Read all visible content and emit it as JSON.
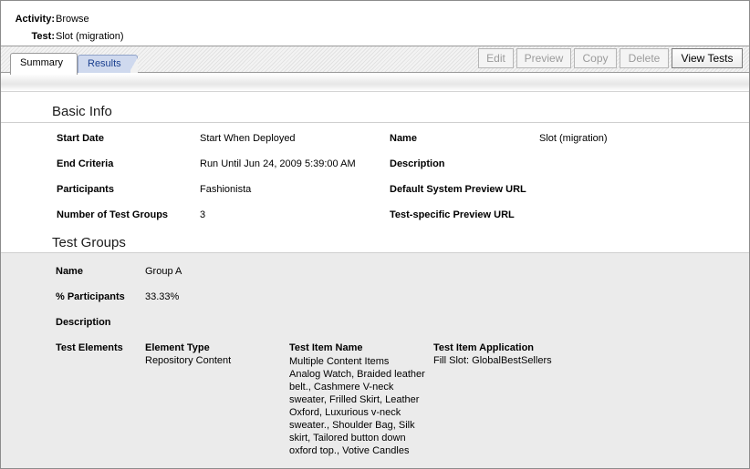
{
  "header": {
    "activity_label": "Activity:",
    "activity_value": "Browse",
    "test_label": "Test:",
    "test_value": "Slot (migration)"
  },
  "tabs": [
    {
      "label": "Summary"
    },
    {
      "label": "Results"
    }
  ],
  "toolbar": {
    "edit": "Edit",
    "preview": "Preview",
    "copy": "Copy",
    "delete": "Delete",
    "view_tests": "View Tests"
  },
  "basic_info": {
    "title": "Basic Info",
    "start_date_label": "Start Date",
    "start_date_value": "Start When Deployed",
    "end_criteria_label": "End Criteria",
    "end_criteria_value": "Run Until Jun 24, 2009 5:39:00 AM",
    "participants_label": "Participants",
    "participants_value": "Fashionista",
    "num_groups_label": "Number of Test Groups",
    "num_groups_value": "3",
    "name_label": "Name",
    "name_value": "Slot (migration)",
    "description_label": "Description",
    "default_preview_label": "Default System Preview URL",
    "test_preview_label": "Test-specific Preview URL"
  },
  "test_groups": {
    "title": "Test Groups",
    "name_label": "Name",
    "name_value": "Group A",
    "participants_label": "% Participants",
    "participants_value": "33.33%",
    "description_label": "Description",
    "elements_label": "Test Elements",
    "element_type_header": "Element Type",
    "element_type_value": "Repository Content",
    "item_name_header": "Test Item Name",
    "item_name_lines": [
      "Multiple Content Items",
      "Analog Watch, Braided leather",
      "belt., Cashmere V-neck",
      "sweater, Frilled Skirt, Leather",
      "Oxford, Luxurious v-neck",
      "sweater., Shoulder Bag, Silk",
      "skirt, Tailored button down",
      "oxford top., Votive Candles"
    ],
    "item_app_header": "Test Item Application",
    "item_app_value": "Fill Slot: GlobalBestSellers"
  }
}
